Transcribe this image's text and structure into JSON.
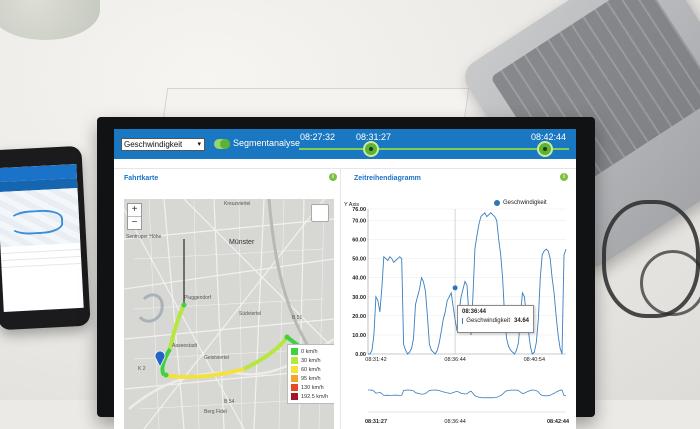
{
  "toolbar": {
    "metric_select": "Geschwindigkeit",
    "segment_label": "Segmentanalyse",
    "times": [
      "08:27:32",
      "08:31:27",
      "08:42:44"
    ]
  },
  "panels": {
    "map_title": "Fahrtkarte",
    "chart_title": "Zeitreihendiagramm"
  },
  "map": {
    "zoom_in": "+",
    "zoom_out": "−",
    "place_labels": [
      "Kreuzviertel",
      "Sentruper Höhe",
      "Pluggendorf",
      "Aaseestadt",
      "Geistviertel",
      "Münster",
      "Südviertel",
      "Berg Fidel",
      "B 51",
      "B 54",
      "K 2"
    ],
    "legend": [
      {
        "label": "0 km/h",
        "color": "#3fd13f"
      },
      {
        "label": "30 km/h",
        "color": "#b7e640"
      },
      {
        "label": "60 km/h",
        "color": "#f2e23b"
      },
      {
        "label": "95 km/h",
        "color": "#f2a32a"
      },
      {
        "label": "130 km/h",
        "color": "#e24a2a"
      },
      {
        "label": "192.5 km/h",
        "color": "#a3162a"
      }
    ]
  },
  "chart_data": {
    "type": "line",
    "ylabel": "Y Axis",
    "ylim": [
      0,
      76
    ],
    "yticks": [
      "76.00",
      "70.00",
      "60.00",
      "50.00",
      "40.00",
      "30.00",
      "20.00",
      "10.00",
      "0.00"
    ],
    "xticks": [
      "08:31:42",
      "08:36:44",
      "08:40:54"
    ],
    "bottom_xticks": [
      "08:31:27",
      "08:36:44",
      "08:42:44"
    ],
    "series": [
      {
        "name": "Geschwindigkeit",
        "color": "#3a7fbf",
        "x": [
          0,
          1,
          2,
          3,
          4,
          5,
          6,
          7,
          8,
          9,
          10,
          11,
          12,
          13,
          14,
          15,
          16,
          17,
          18,
          19,
          20,
          21,
          22,
          23,
          24,
          25,
          26,
          27,
          28,
          29,
          30,
          31,
          32,
          33,
          34,
          35,
          36,
          37,
          38,
          39,
          40,
          41,
          42,
          43,
          44,
          45,
          46,
          47,
          48,
          49,
          50,
          51,
          52,
          53,
          54,
          55,
          56,
          57,
          58,
          59,
          60,
          61,
          62,
          63,
          64,
          65,
          66,
          67,
          68,
          69,
          70,
          71,
          72,
          73,
          74,
          75,
          76,
          77,
          78,
          79,
          80,
          81,
          82,
          83,
          84,
          85,
          86,
          87,
          88,
          89,
          90,
          91,
          92,
          93,
          94,
          95,
          96,
          97,
          98,
          99,
          100
        ],
        "values": [
          0,
          0,
          2,
          10,
          30,
          28,
          22,
          35,
          51,
          50,
          49,
          51,
          50,
          48,
          49,
          50,
          51,
          50,
          5,
          2,
          0,
          1,
          3,
          8,
          26,
          30,
          34,
          40,
          38,
          33,
          20,
          5,
          2,
          1,
          0,
          2,
          6,
          12,
          18,
          22,
          28,
          30,
          32,
          25,
          18,
          12,
          22,
          30,
          34,
          38,
          36,
          20,
          10,
          30,
          55,
          62,
          68,
          72,
          73,
          74,
          72,
          73,
          74,
          73,
          72,
          70,
          60,
          52,
          40,
          20,
          8,
          4,
          2,
          1,
          0,
          2,
          6,
          20,
          32,
          30,
          20,
          12,
          4,
          0,
          1,
          6,
          18,
          40,
          52,
          54,
          55,
          54,
          50,
          40,
          32,
          20,
          10,
          3,
          0,
          52,
          55
        ]
      }
    ],
    "tooltip": {
      "time": "08:36:44",
      "name": "Geschwindigkeit",
      "value": "34.64"
    }
  }
}
